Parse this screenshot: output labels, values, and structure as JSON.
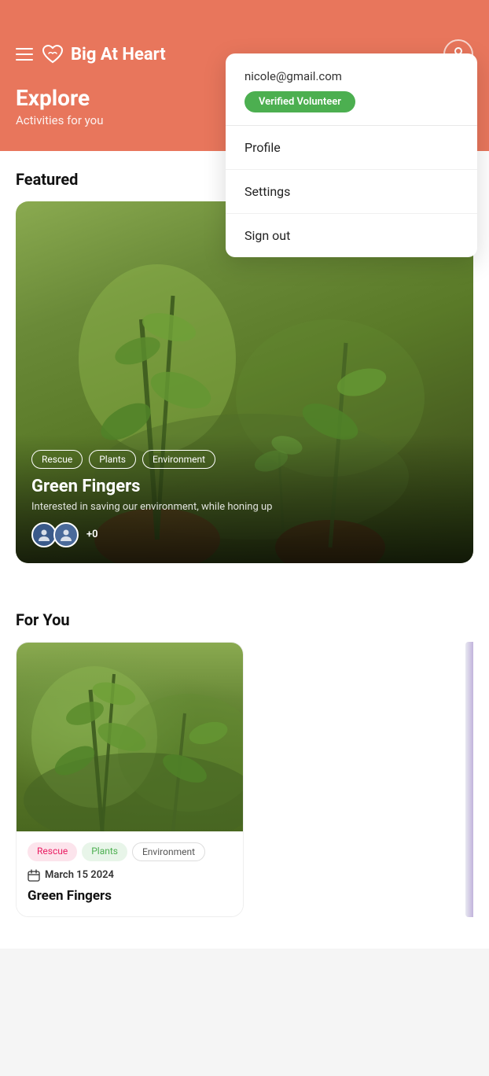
{
  "app": {
    "name": "Big At Heart",
    "logo_alt": "heart-logo"
  },
  "header": {
    "title": "Explore",
    "subtitle": "Activities for you"
  },
  "user": {
    "email": "nicole@gmail.com",
    "badge": "Verified Volunteer"
  },
  "dropdown": {
    "items": [
      {
        "id": "profile",
        "label": "Profile"
      },
      {
        "id": "settings",
        "label": "Settings"
      },
      {
        "id": "signout",
        "label": "Sign out"
      }
    ]
  },
  "featured": {
    "section_title": "Featured",
    "card": {
      "tags": [
        "Rescue",
        "Plants",
        "Environment"
      ],
      "title": "Green Fingers",
      "description": "Interested in saving our environment, while honing up",
      "participant_count": "+0"
    }
  },
  "for_you": {
    "section_title": "For You",
    "cards": [
      {
        "tags": [
          {
            "label": "Rescue",
            "type": "pink"
          },
          {
            "label": "Plants",
            "type": "green"
          },
          {
            "label": "Environment",
            "type": "light"
          }
        ],
        "date": "March 15 2024",
        "title": "Green Fingers"
      }
    ]
  }
}
